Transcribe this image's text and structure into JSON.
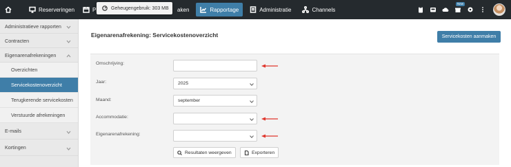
{
  "topbar": {
    "items": [
      {
        "label": "Reserveringen",
        "icon": "monitor-icon"
      },
      {
        "label": "Plan",
        "icon": "calendar-icon"
      },
      {
        "label": "aken",
        "icon": ""
      },
      {
        "label": "Rapportage",
        "icon": "chart-icon"
      },
      {
        "label": "Administratie",
        "icon": "ledger-icon"
      },
      {
        "label": "Channels",
        "icon": "network-icon"
      }
    ],
    "right_icons": [
      "clipboard-icon",
      "inbox-icon",
      "cloud-download-icon",
      "gift-icon",
      "settings-icon",
      "more-icon"
    ],
    "badge": "New"
  },
  "memory_popup": {
    "text": "Geheugengebruik: 303 MB"
  },
  "sidebar": {
    "items": [
      {
        "label": "Administratieve rapporten"
      },
      {
        "label": "Contracten"
      },
      {
        "label": "Eigenarenafrekeningen"
      }
    ],
    "subitems": [
      {
        "label": "Overzichten"
      },
      {
        "label": "Servicekostenoverzicht"
      },
      {
        "label": "Terugkerende servicekosten"
      },
      {
        "label": "Verstuurde afrekeningen"
      }
    ],
    "bottom_items": [
      {
        "label": "E-mails"
      },
      {
        "label": "Kortingen"
      }
    ]
  },
  "main": {
    "title": "Eigenarenafrekening: Servicekostenoverzicht",
    "create_button": "Servicekosten aanmaken",
    "form": {
      "omschrijving_label": "Omschrijving:",
      "omschrijving_value": "",
      "jaar_label": "Jaar:",
      "jaar_value": "2025",
      "maand_label": "Maand:",
      "maand_value": "september",
      "accommodatie_label": "Accommodatie:",
      "accommodatie_value": "",
      "eigenaren_label": "Eigenarenafrekening:",
      "eigenaren_value": "",
      "show_results_button": "Resultaten weergeven",
      "export_button": "Exporteren"
    }
  },
  "colors": {
    "accent": "#3f7ea8",
    "topbar": "#252a2e",
    "annotation_arrow": "#e0362c"
  }
}
